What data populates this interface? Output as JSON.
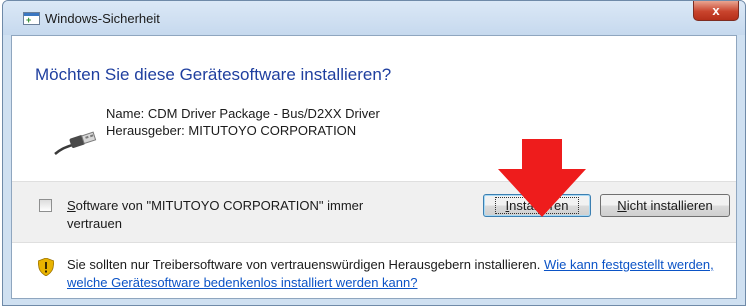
{
  "window": {
    "title": "Windows-Sicherheit",
    "close_glyph": "x"
  },
  "heading": "Möchten Sie diese Gerätesoftware installieren?",
  "device": {
    "icon": "usb-plug-icon",
    "name_line": "Name: CDM Driver Package - Bus/D2XX Driver",
    "publisher_line": "Herausgeber: MITUTOYO CORPORATION"
  },
  "trust": {
    "checked": false,
    "label_first_char": "S",
    "label_rest": "oftware von \"MITUTOYO CORPORATION\" immer vertrauen"
  },
  "buttons": {
    "install_first_char": "I",
    "install_rest": "nstallieren",
    "dont_install_first_char": "N",
    "dont_install_rest": "icht installieren"
  },
  "annotation": {
    "arrow_color": "#ee1c1c"
  },
  "warning": {
    "icon": "shield-warning-icon",
    "text": "Sie sollten nur Treibersoftware von vertrauenswürdigen Herausgebern installieren.",
    "link": "Wie kann festgestellt werden, welche Gerätesoftware bedenkenlos installiert werden kann?"
  }
}
